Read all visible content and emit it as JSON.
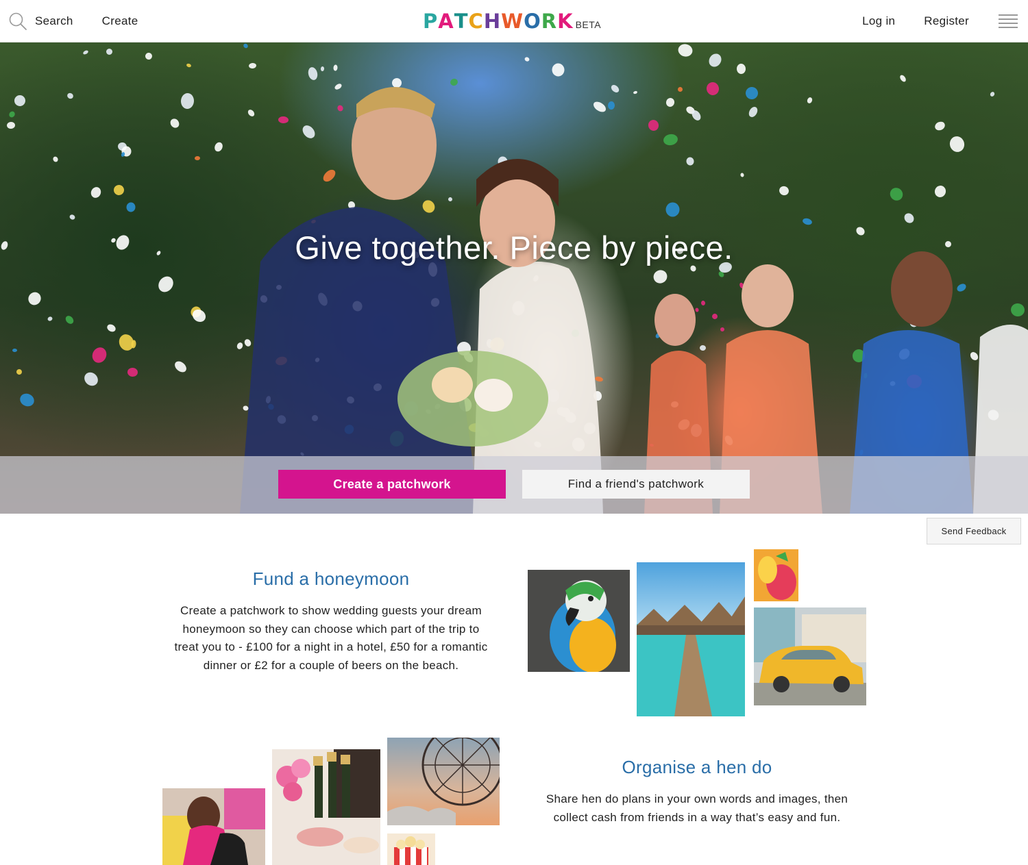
{
  "header": {
    "search_label": "Search",
    "create_label": "Create",
    "logo_letters": [
      {
        "char": "P",
        "color": "#2aa6a0"
      },
      {
        "char": "A",
        "color": "#e21b7c"
      },
      {
        "char": "T",
        "color": "#1a8f8a"
      },
      {
        "char": "C",
        "color": "#e9a219"
      },
      {
        "char": "H",
        "color": "#6a3d9a"
      },
      {
        "char": "W",
        "color": "#e85a2a"
      },
      {
        "char": "O",
        "color": "#2a6ea8"
      },
      {
        "char": "R",
        "color": "#3ea84a"
      },
      {
        "char": "K",
        "color": "#e21b7c"
      }
    ],
    "logo_beta": "BETA",
    "login_label": "Log in",
    "register_label": "Register"
  },
  "hero": {
    "title": "Give together. Piece by piece.",
    "primary_cta": "Create a patchwork",
    "secondary_cta": "Find a friend's patchwork"
  },
  "feedback_label": "Send Feedback",
  "honeymoon": {
    "title": "Fund a honeymoon",
    "lines": [
      "Create a patchwork to show wedding guests your dream",
      "honeymoon so they can choose which part of the trip to",
      "treat you to - £100 for a night in a hotel, £50 for a romantic",
      "dinner or £2 for a couple of beers on the beach."
    ]
  },
  "hendo": {
    "title": "Organise a hen do",
    "lines": [
      "Share hen do plans in your own words and images, then",
      "collect cash from friends in a way that’s easy and fun."
    ]
  },
  "colors": {
    "accent": "#d4148e",
    "section_title": "#2a6ea8"
  }
}
